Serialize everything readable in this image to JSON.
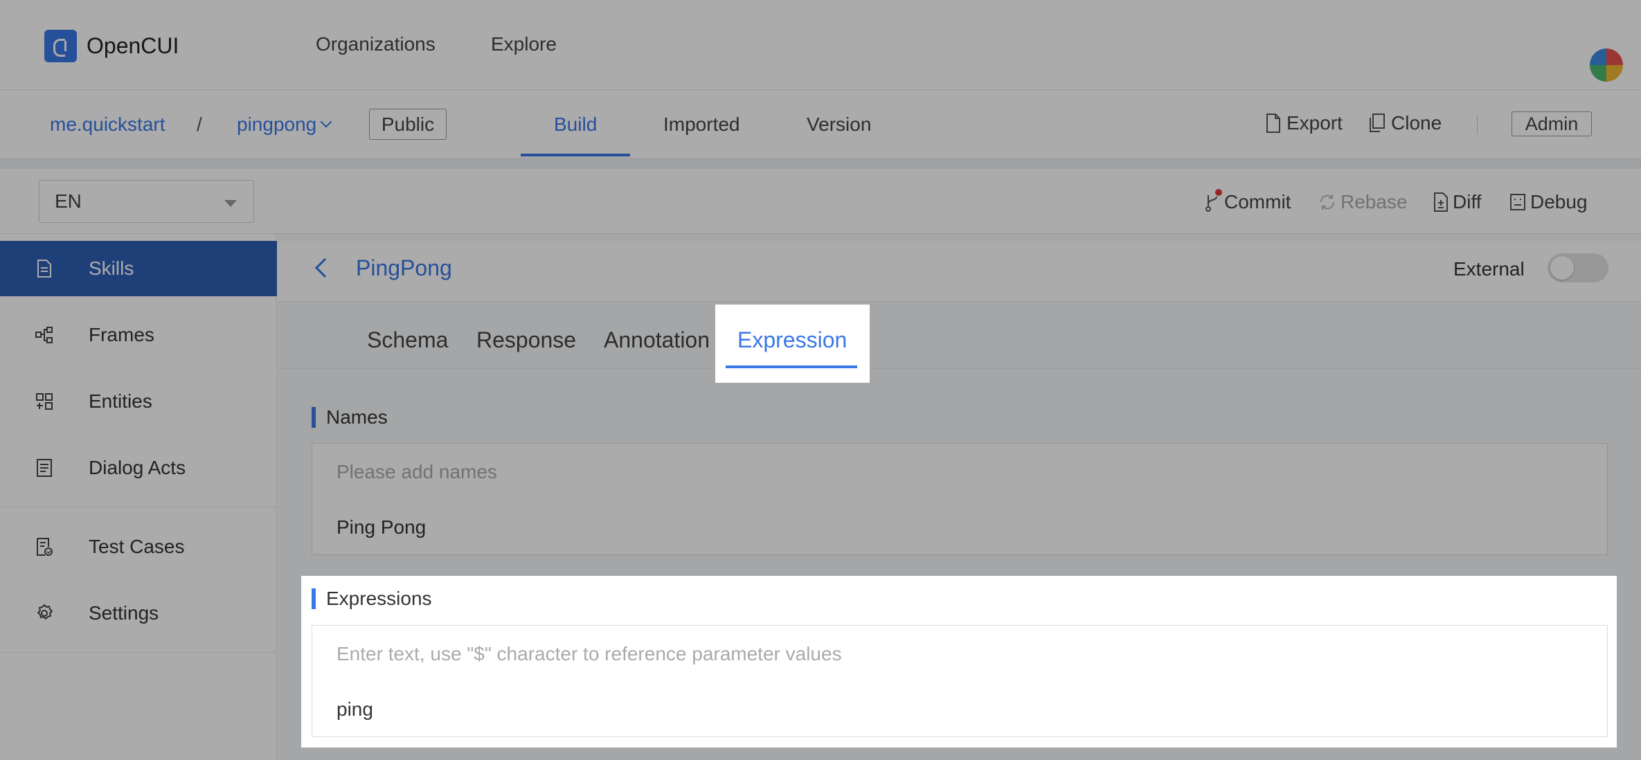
{
  "brand": {
    "name": "OpenCUI"
  },
  "topnav": {
    "organizations": "Organizations",
    "explore": "Explore"
  },
  "project": {
    "org": "me.quickstart",
    "separator": "/",
    "name": "pingpong",
    "visibility": "Public",
    "tabs": [
      "Build",
      "Imported",
      "Version"
    ],
    "active_tab": "Build",
    "actions": {
      "export": "Export",
      "clone": "Clone",
      "admin": "Admin"
    }
  },
  "toolbar": {
    "language": "EN",
    "commit": "Commit",
    "rebase": "Rebase",
    "diff": "Diff",
    "debug": "Debug"
  },
  "sidebar": {
    "items": [
      {
        "label": "Skills",
        "icon": "document-icon",
        "active": true
      },
      {
        "label": "Frames",
        "icon": "frames-icon"
      },
      {
        "label": "Entities",
        "icon": "entities-icon"
      },
      {
        "label": "Dialog Acts",
        "icon": "dialog-acts-icon"
      },
      {
        "label": "Test Cases",
        "icon": "test-cases-icon"
      },
      {
        "label": "Settings",
        "icon": "gear-icon"
      }
    ]
  },
  "skill": {
    "title": "PingPong",
    "external_label": "External",
    "external_on": false,
    "tabs": [
      "Schema",
      "Response",
      "Annotation",
      "Expression"
    ],
    "active_tab": "Expression"
  },
  "names": {
    "label": "Names",
    "placeholder": "Please add names",
    "values": [
      "Ping Pong"
    ]
  },
  "expressions": {
    "label": "Expressions",
    "placeholder": "Enter text, use \"$\" character to reference parameter values",
    "values": [
      "ping"
    ]
  },
  "colors": {
    "accent": "#3a78e6",
    "sidebar_active": "#2f5fb5",
    "commit_dot": "#e23b3b"
  }
}
